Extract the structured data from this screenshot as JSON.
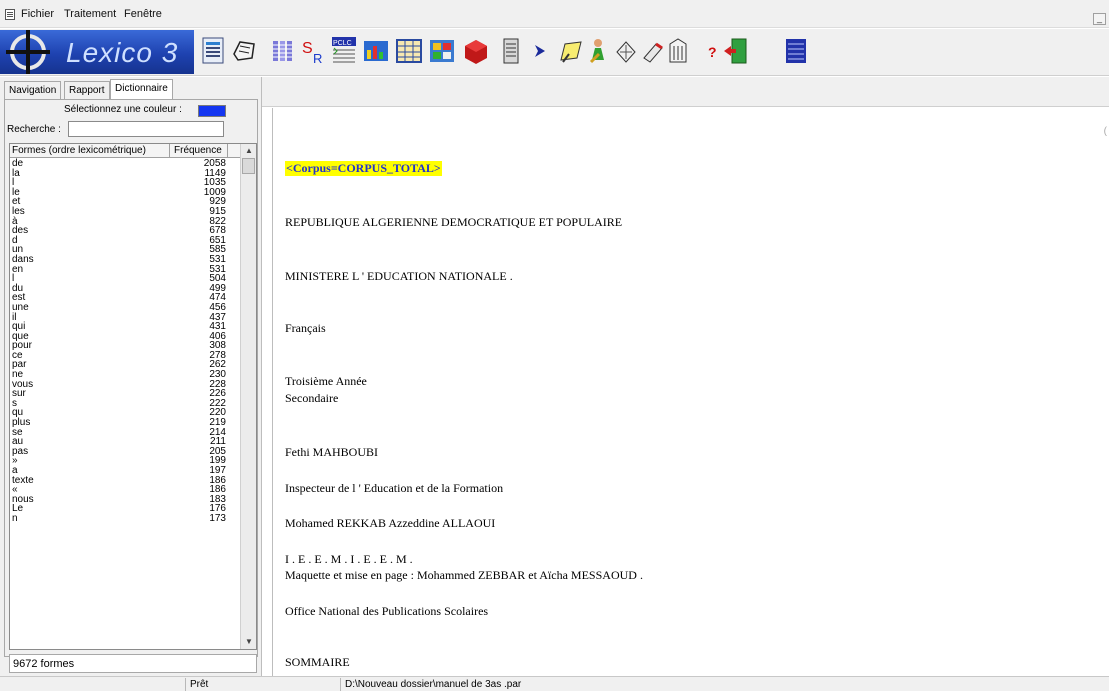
{
  "menu": {
    "items": [
      "Fichier",
      "Traitement",
      "Fenêtre"
    ],
    "minimize": "_"
  },
  "toolbar": {
    "app_name": "Lexico 3",
    "icons": [
      "document-list-icon",
      "open-hand-icon",
      "segments-icon",
      "sr-icon",
      "pclc-icon",
      "chart-icon",
      "table-icon",
      "grid-icon",
      "red-cube-icon",
      "book-icon",
      "arrow-icon",
      "pencil-icon",
      "person-icon",
      "tools-icon",
      "pen-icon",
      "question-icon",
      "exit-door-icon",
      "cabinet-icon"
    ],
    "colors": {
      "logo": "#1e42b0",
      "sr_red": "#d01010"
    }
  },
  "left_panel": {
    "tabs": [
      "Navigation",
      "Rapport",
      "Dictionnaire"
    ],
    "active_tab": "Dictionnaire",
    "color_label": "Sélectionnez une couleur :",
    "color_value": "#1436f0",
    "search_label": "Recherche :",
    "search_value": "",
    "columns": [
      "Formes (ordre lexicométrique)",
      "Fréquence"
    ],
    "rows": [
      [
        "de",
        "2058"
      ],
      [
        "la",
        "1149"
      ],
      [
        "l",
        "1035"
      ],
      [
        "le",
        "1009"
      ],
      [
        "et",
        "929"
      ],
      [
        "les",
        "915"
      ],
      [
        "à",
        "822"
      ],
      [
        "des",
        "678"
      ],
      [
        "d",
        "651"
      ],
      [
        "un",
        "585"
      ],
      [
        "dans",
        "531"
      ],
      [
        "en",
        "531"
      ],
      [
        "l",
        "504"
      ],
      [
        "du",
        "499"
      ],
      [
        "est",
        "474"
      ],
      [
        "une",
        "456"
      ],
      [
        "il",
        "437"
      ],
      [
        "qui",
        "431"
      ],
      [
        "que",
        "406"
      ],
      [
        "pour",
        "308"
      ],
      [
        "ce",
        "278"
      ],
      [
        "par",
        "262"
      ],
      [
        "ne",
        "230"
      ],
      [
        "vous",
        "228"
      ],
      [
        "sur",
        "226"
      ],
      [
        "s",
        "222"
      ],
      [
        "qu",
        "220"
      ],
      [
        "plus",
        "219"
      ],
      [
        "se",
        "214"
      ],
      [
        "au",
        "211"
      ],
      [
        "pas",
        "205"
      ],
      [
        "»",
        "199"
      ],
      [
        "a",
        "197"
      ],
      [
        "texte",
        "186"
      ],
      [
        "«",
        "186"
      ],
      [
        "nous",
        "183"
      ],
      [
        "Le",
        "176"
      ],
      [
        "n",
        "173"
      ]
    ],
    "count": "9672 formes"
  },
  "document": {
    "lines": [
      {
        "text": "<Corpus=CORPUS_TOTAL>",
        "highlight": true
      },
      {
        "text": "REPUBLIQUE ALGERIENNE DEMOCRATIQUE ET POPULAIRE"
      },
      {
        "text": "MINISTERE L ' EDUCATION NATIONALE ."
      },
      {
        "text": "Français"
      },
      {
        "text": "Troisième Année"
      },
      {
        "text": "Secondaire"
      },
      {
        "text": "Fethi MAHBOUBI"
      },
      {
        "text": "Inspecteur de l ' Education et de la Formation"
      },
      {
        "text": "Mohamed REKKAB Azzeddine ALLAOUI"
      },
      {
        "text": "I . E . E . M . I . E . E . M ."
      },
      {
        "text": "Maquette et mise en page : Mohammed ZEBBAR et Aïcha MESSAOUD ."
      },
      {
        "text": "Office National des Publications Scolaires"
      },
      {
        "text": "SOMMAIRE"
      }
    ]
  },
  "statusbar": {
    "status": "Prêt",
    "path": "D:\\Nouveau dossier\\manuel de 3as .par"
  }
}
